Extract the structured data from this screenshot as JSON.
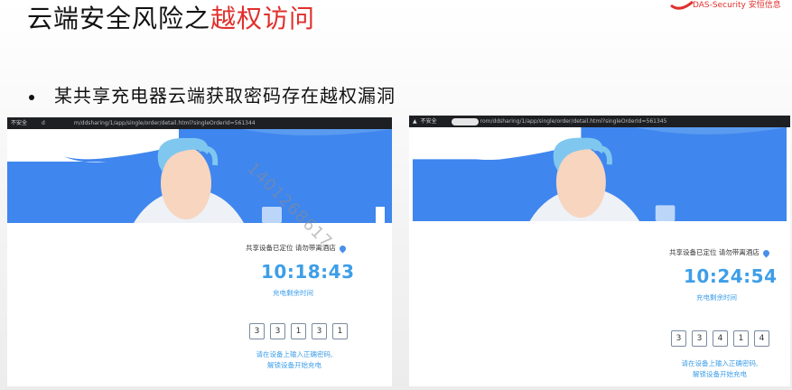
{
  "slide": {
    "title_prefix": "云端安全风险之",
    "title_highlight": "越权访问",
    "bullet": "某共享充电器云端获取密码存在越权漏洞",
    "logo_text": "DAS-Security 安恒信息",
    "watermark": "1401268617"
  },
  "screens": [
    {
      "not_secure": "不安全",
      "url_fragment": "d",
      "url": "m/ddsharing/1/app/single/order/detail.html?singleOrderId=561344",
      "location_text": "共享设备已定位  请勿带离酒店",
      "timer": "10:18:43",
      "timer_label": "充电剩余时间",
      "password_digits": [
        "3",
        "3",
        "1",
        "3",
        "1"
      ],
      "instruction_line1": "请在设备上输入正确密码,",
      "instruction_line2": "解锁设备开始充电"
    },
    {
      "not_secure": "不安全",
      "url_fragment": "",
      "url": "rom/ddsharing/1/app/single/order/detail.html?singleOrderId=561345",
      "location_text": "共享设备已定位  请勿带离酒店",
      "timer": "10:24:54",
      "timer_label": "充电剩余时间",
      "password_digits": [
        "3",
        "3",
        "4",
        "1",
        "4"
      ],
      "instruction_line1": "请在设备上输入正确密码,",
      "instruction_line2": "解锁设备开始充电"
    }
  ],
  "colors": {
    "accent_red": "#e0302d",
    "hero_blue": "#3f86ee",
    "timer_blue": "#3d9ee8"
  }
}
